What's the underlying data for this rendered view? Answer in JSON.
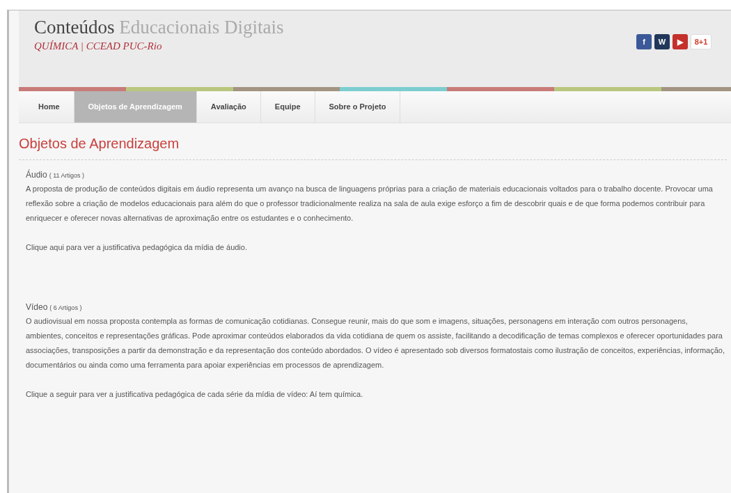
{
  "header": {
    "title_dark": "Conteúdos",
    "title_light": "Educacionais Digitais",
    "subtitle": "QUÍMICA | CCEAD PUC-Rio",
    "social": [
      {
        "kind": "facebook",
        "label": "f"
      },
      {
        "kind": "wordpress",
        "label": "W"
      },
      {
        "kind": "youtube",
        "label": "▶"
      },
      {
        "kind": "googleplus",
        "label": "8+1"
      }
    ]
  },
  "stripes": [
    {
      "color": "#c87b78"
    },
    {
      "color": "#b9c77e"
    },
    {
      "color": "#a39482"
    },
    {
      "color": "#7ccdd0"
    },
    {
      "color": "#c87b78"
    },
    {
      "color": "#b9c77e"
    },
    {
      "color": "#a39482"
    }
  ],
  "nav": [
    {
      "label": "Home",
      "selected": false
    },
    {
      "label": "Objetos de Aprendizagem",
      "selected": true
    },
    {
      "label": "Avaliação",
      "selected": false
    },
    {
      "label": "Equipe",
      "selected": false
    },
    {
      "label": "Sobre o Projeto",
      "selected": false
    }
  ],
  "page_title": "Objetos de Aprendizagem",
  "sections": [
    {
      "title": "Áudio",
      "count": "( 11 Artigos )",
      "paragraphs": [
        "A proposta de produção de conteúdos digitais em áudio representa um avanço na busca de linguagens próprias para a criação de materiais educacionais voltados para o trabalho docente. Provocar uma reflexão sobre a criação de modelos educacionais para além do que o professor tradicionalmente realiza na sala de aula exige esforço a fim de descobrir quais e de que forma podemos contribuir para enriquecer e oferecer novas alternativas de aproximação entre os estudantes e o conhecimento.",
        "Clique aqui para ver a justificativa pedagógica da mídia de áudio."
      ]
    },
    {
      "title": "Vídeo",
      "count": "( 6 Artigos )",
      "paragraphs": [
        "O audiovisual em nossa proposta contempla as formas de comunicação cotidianas. Consegue reunir, mais do que som e imagens, situações, personagens em interação com outros personagens, ambientes, conceitos e representações gráficas. Pode aproximar conteúdos elaborados da vida cotidiana de quem os assiste, facilitando a decodificação de temas complexos e oferecer oportunidades para associações, transposições a partir da demonstração e da representação dos conteúdo abordados. O vídeo é apresentado sob diversos formatostais como ilustração de conceitos, experiências, informação, documentários ou ainda como uma ferramenta para apoiar experiências em processos de aprendizagem.",
        "Clique a seguir para ver a justificativa pedagógica de cada série da mídia de vídeo: Aí tem química."
      ]
    }
  ]
}
